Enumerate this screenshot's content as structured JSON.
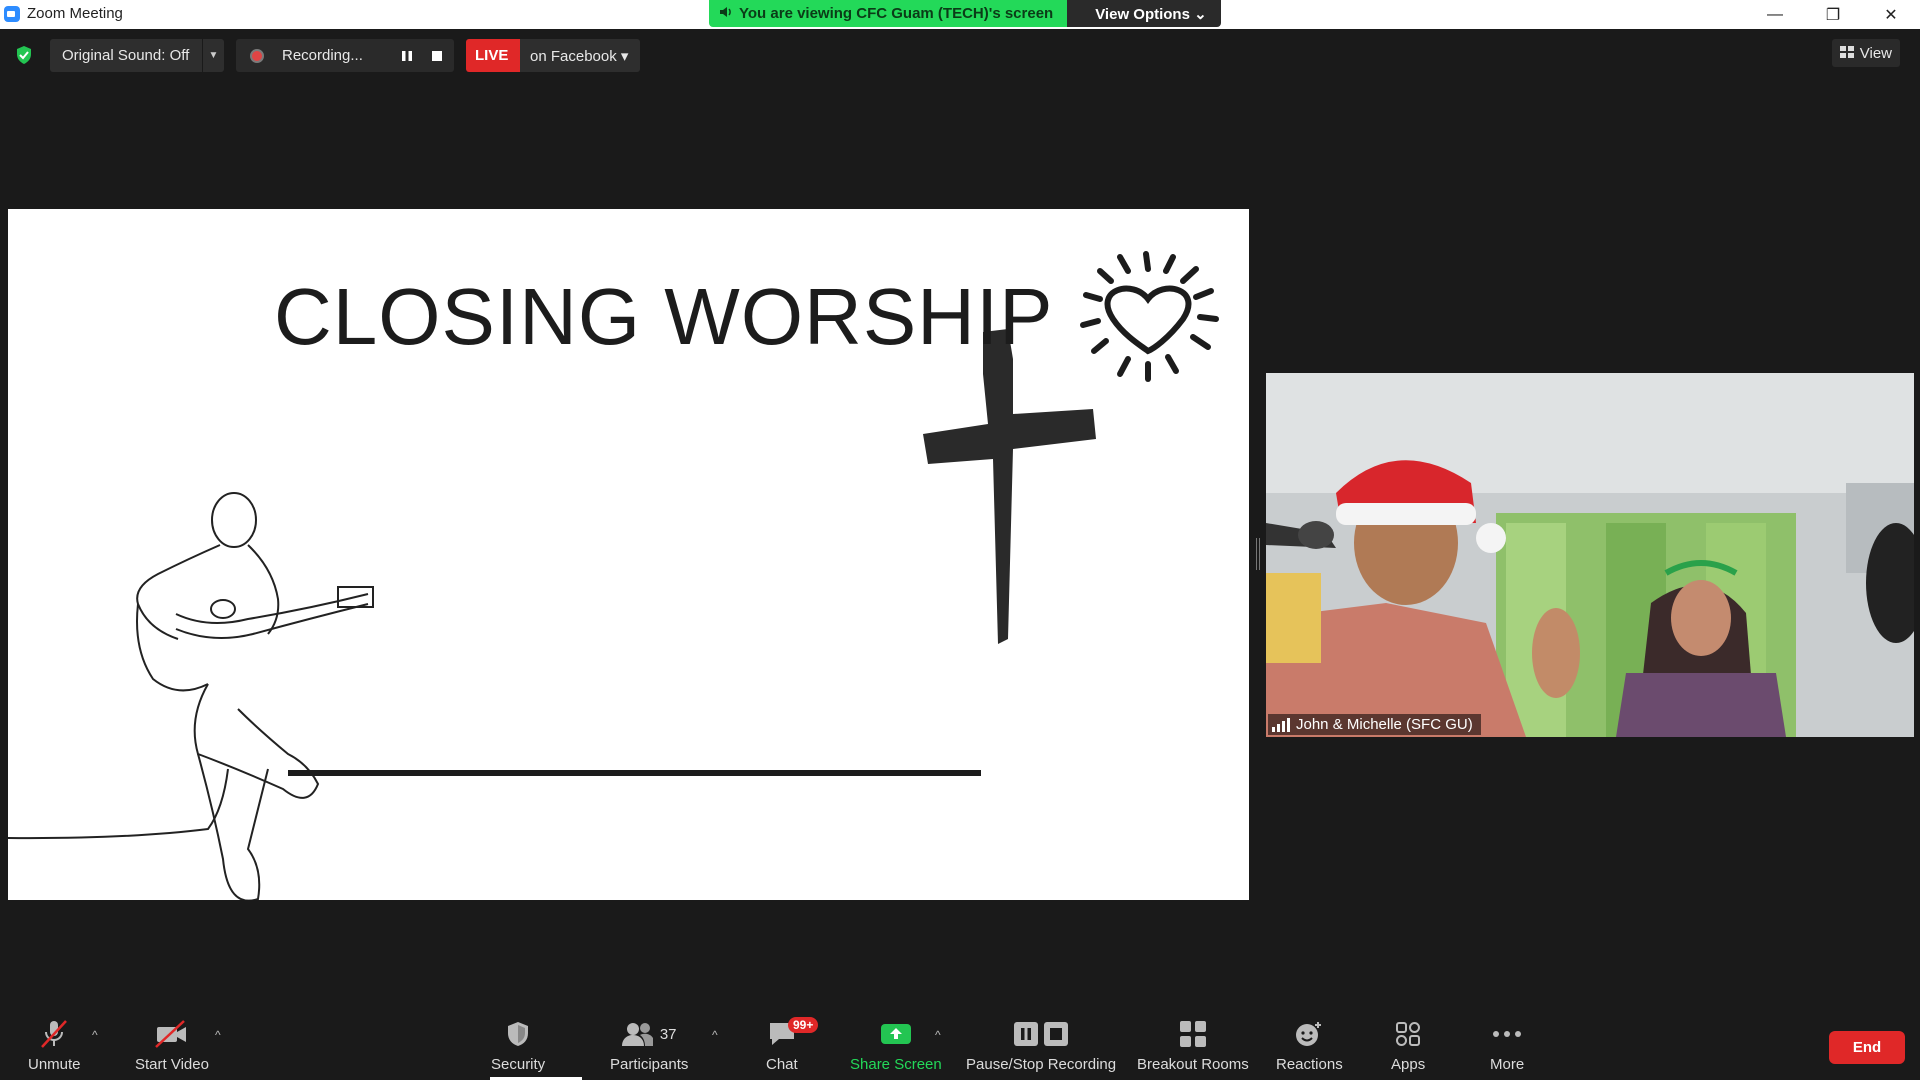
{
  "window": {
    "title": "Zoom Meeting",
    "controls": [
      "—",
      "❐",
      "✕"
    ]
  },
  "banner": {
    "viewing_text": "You are viewing CFC Guam (TECH)'s screen",
    "view_options": "View Options ⌄"
  },
  "top_toolbar": {
    "original_sound": "Original Sound: Off",
    "recording": "Recording...",
    "live": "LIVE",
    "live_target": "on Facebook",
    "view": "View"
  },
  "slide": {
    "title": "CLOSING WORSHIP"
  },
  "video": {
    "participant_name": "John & Michelle (SFC GU)"
  },
  "bottom_toolbar": {
    "unmute": "Unmute",
    "start_video": "Start Video",
    "security": "Security",
    "participants": "Participants",
    "participants_count": "37",
    "chat": "Chat",
    "chat_badge": "99+",
    "share_screen": "Share Screen",
    "pause_stop_recording": "Pause/Stop Recording",
    "breakout_rooms": "Breakout Rooms",
    "reactions": "Reactions",
    "apps": "Apps",
    "more": "More",
    "end": "End"
  },
  "colors": {
    "accent_green": "#23d959",
    "live_red": "#e02828",
    "toolbar_bg": "#1a1a1a"
  }
}
